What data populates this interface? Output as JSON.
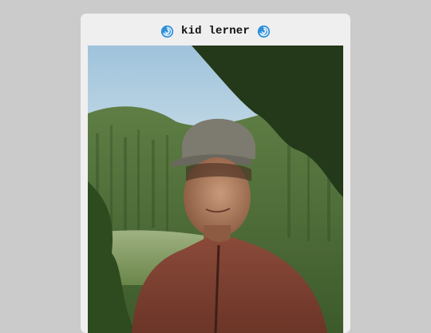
{
  "profile": {
    "title": "kid lerner",
    "left_icon": "cyclone-emoji-icon",
    "right_icon": "cyclone-emoji-icon",
    "photo_subject": "profile-photo"
  },
  "colors": {
    "background": "#cbcbcb",
    "card": "#efefef",
    "swirl": "#2f8fd8"
  }
}
